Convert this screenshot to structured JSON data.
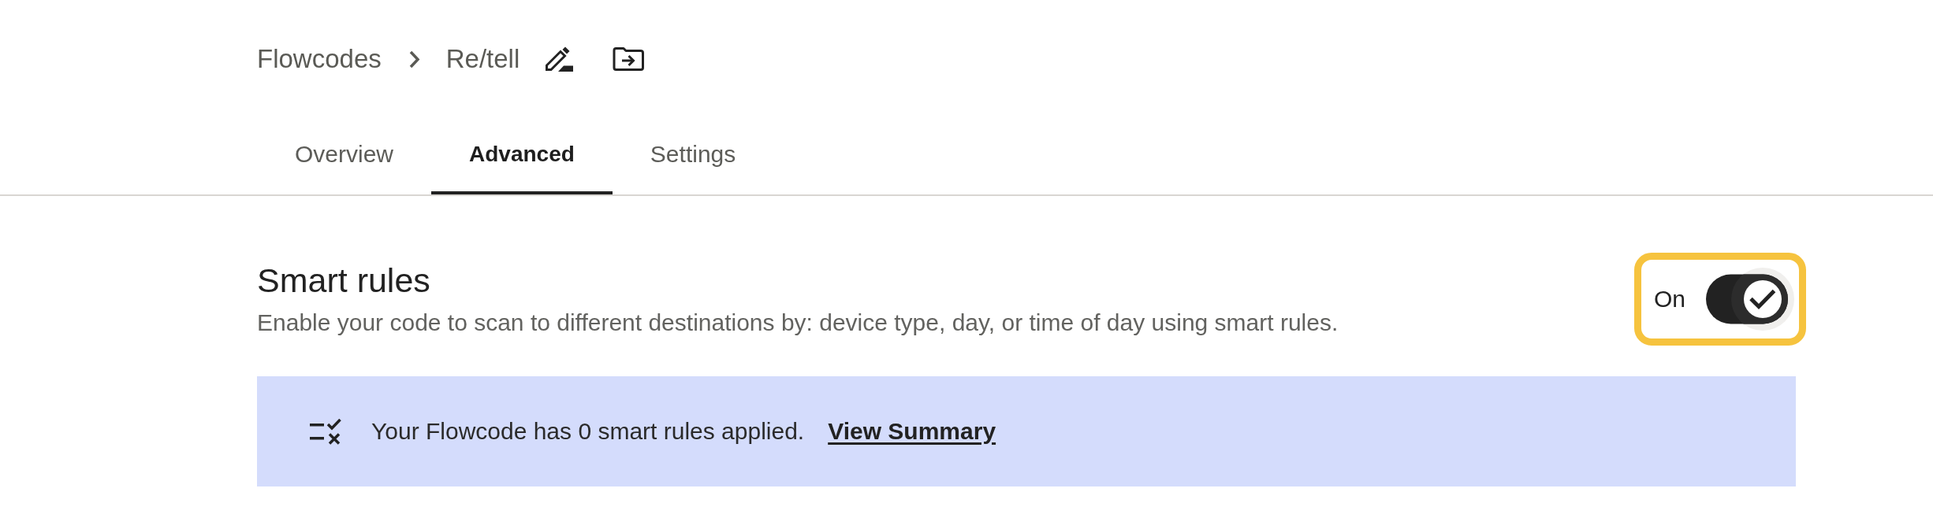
{
  "breadcrumb": {
    "items": [
      {
        "label": "Flowcodes"
      },
      {
        "label": "Re/tell"
      }
    ]
  },
  "tabs": [
    {
      "label": "Overview",
      "selected": false
    },
    {
      "label": "Advanced",
      "selected": true
    },
    {
      "label": "Settings",
      "selected": false
    }
  ],
  "smart_rules": {
    "title": "Smart rules",
    "description": "Enable your code to scan to different destinations by: device type, day, or time of day using smart rules.",
    "toggle": {
      "label": "On",
      "on": true,
      "highlighted": true
    }
  },
  "banner": {
    "message": "Your Flowcode has 0 smart rules applied.",
    "link": "View Summary"
  }
}
